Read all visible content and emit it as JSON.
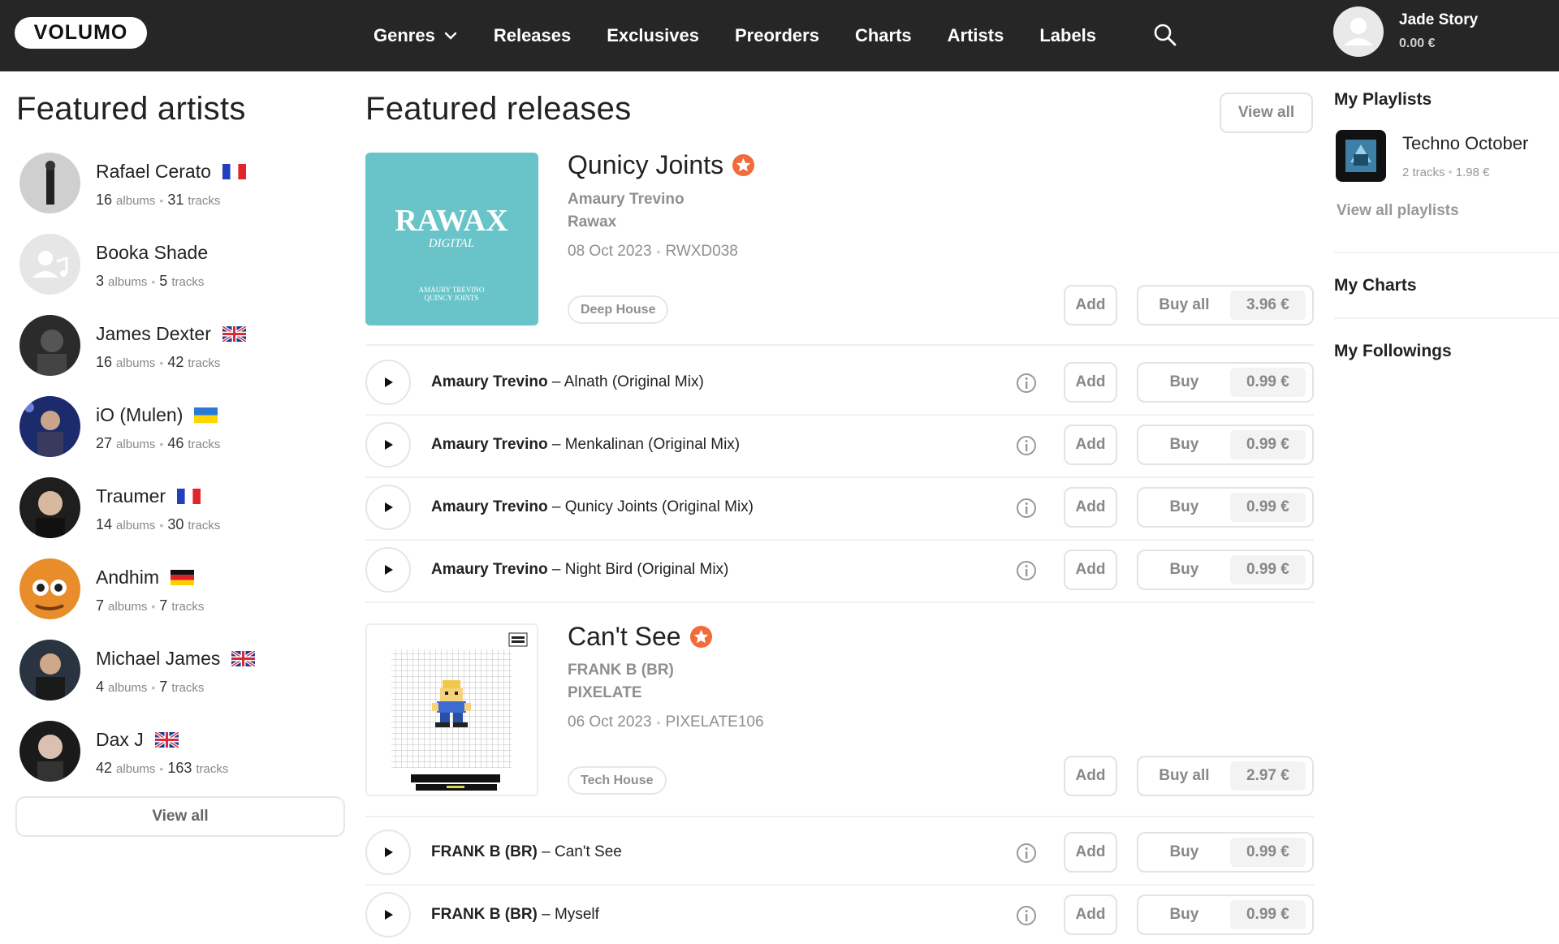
{
  "header": {
    "logo": "VOLUMO",
    "nav": [
      "Genres",
      "Releases",
      "Exclusives",
      "Preorders",
      "Charts",
      "Artists",
      "Labels"
    ],
    "user_name": "Jade Story",
    "user_balance": "0.00 €"
  },
  "featured_artists": {
    "title": "Featured artists",
    "items": [
      {
        "name": "Rafael Cerato",
        "flag": "fr",
        "albums": "16",
        "tracks": "31"
      },
      {
        "name": "Booka Shade",
        "flag": "",
        "albums": "3",
        "tracks": "5"
      },
      {
        "name": "James Dexter",
        "flag": "uk",
        "albums": "16",
        "tracks": "42"
      },
      {
        "name": "iO (Mulen)",
        "flag": "ua",
        "albums": "27",
        "tracks": "46"
      },
      {
        "name": "Traumer",
        "flag": "fr",
        "albums": "14",
        "tracks": "30"
      },
      {
        "name": "Andhim",
        "flag": "de",
        "albums": "7",
        "tracks": "7"
      },
      {
        "name": "Michael James",
        "flag": "uk",
        "albums": "4",
        "tracks": "7"
      },
      {
        "name": "Dax J",
        "flag": "uk",
        "albums": "42",
        "tracks": "163"
      }
    ],
    "albums_word": "albums",
    "tracks_word": "tracks",
    "view_all": "View all"
  },
  "featured_releases": {
    "title": "Featured releases",
    "view_all": "View all",
    "add_label": "Add",
    "buy_label": "Buy",
    "buy_all_label": "Buy all",
    "releases": [
      {
        "title": "Qunicy Joints",
        "artist": "Amaury Trevino",
        "label": "Rawax",
        "date": "08 Oct 2023",
        "catalog": "RWXD038",
        "genre": "Deep House",
        "total_price": "3.96 €",
        "cover_text": "RAWAX",
        "cover_subtext": "DIGITAL",
        "cover_credit": "AMAURY TREVINO\nQUINCY JOINTS",
        "tracks": [
          {
            "artist": "Amaury Trevino",
            "title": "Alnath (Original Mix)",
            "price": "0.99 €"
          },
          {
            "artist": "Amaury Trevino",
            "title": "Menkalinan (Original Mix)",
            "price": "0.99 €"
          },
          {
            "artist": "Amaury Trevino",
            "title": "Qunicy Joints (Original Mix)",
            "price": "0.99 €"
          },
          {
            "artist": "Amaury Trevino",
            "title": "Night Bird (Original Mix)",
            "price": "0.99 €"
          }
        ]
      },
      {
        "title": "Can't See",
        "artist": "FRANK B (BR)",
        "label": "PIXELATE",
        "date": "06 Oct 2023",
        "catalog": "PIXELATE106",
        "genre": "Tech House",
        "total_price": "2.97 €",
        "tracks": [
          {
            "artist": "FRANK B (BR)",
            "title": "Can't See",
            "price": "0.99 €"
          },
          {
            "artist": "FRANK B (BR)",
            "title": "Myself",
            "price": "0.99 €"
          }
        ]
      }
    ]
  },
  "sidebar": {
    "playlists_title": "My Playlists",
    "playlist": {
      "name": "Techno October",
      "tracks": "2 tracks",
      "price": "1.98 €"
    },
    "view_all_playlists": "View all playlists",
    "charts_title": "My Charts",
    "followings_title": "My Followings"
  },
  "colors": {
    "header_bg": "#262626",
    "accent": "#f26b3a",
    "muted": "#8f8f8f"
  }
}
